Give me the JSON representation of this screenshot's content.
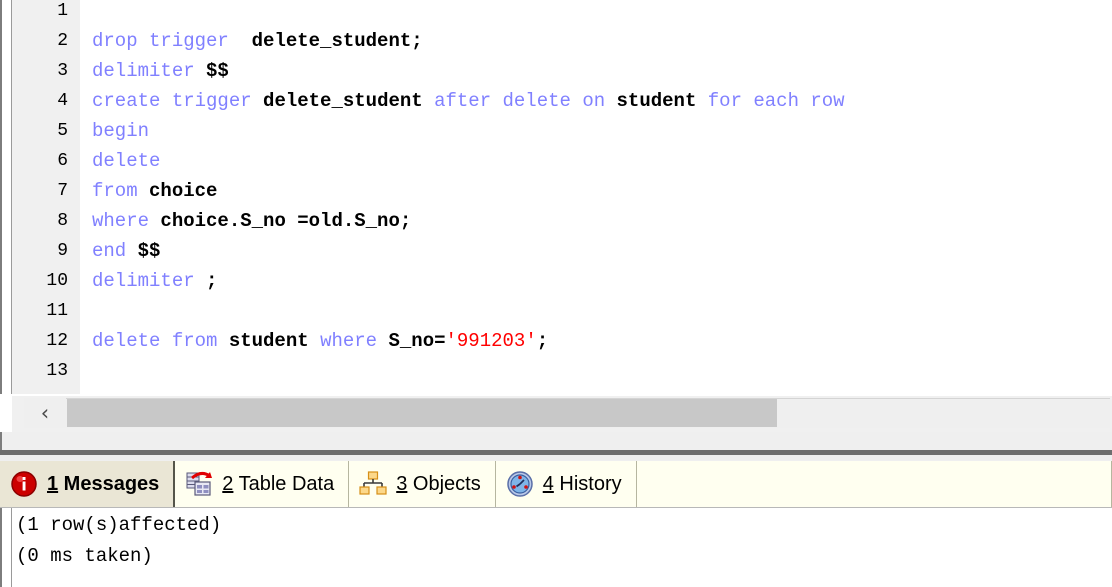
{
  "editor": {
    "lines": [
      {
        "no": "1",
        "tokens": []
      },
      {
        "no": "2",
        "tokens": [
          {
            "t": "drop trigger",
            "c": "kw"
          },
          {
            "t": "  ",
            "c": "ws"
          },
          {
            "t": "delete_student;",
            "c": "pln"
          }
        ]
      },
      {
        "no": "3",
        "tokens": [
          {
            "t": "delimiter",
            "c": "kw"
          },
          {
            "t": " ",
            "c": "ws"
          },
          {
            "t": "$$",
            "c": "pln"
          }
        ]
      },
      {
        "no": "4",
        "tokens": [
          {
            "t": "create trigger",
            "c": "kw"
          },
          {
            "t": " ",
            "c": "ws"
          },
          {
            "t": "delete_student",
            "c": "pln"
          },
          {
            "t": " ",
            "c": "ws"
          },
          {
            "t": "after delete on",
            "c": "kw"
          },
          {
            "t": " ",
            "c": "ws"
          },
          {
            "t": "student",
            "c": "pln"
          },
          {
            "t": " ",
            "c": "ws"
          },
          {
            "t": "for each row",
            "c": "kw"
          }
        ]
      },
      {
        "no": "5",
        "tokens": [
          {
            "t": "begin",
            "c": "kw"
          }
        ]
      },
      {
        "no": "6",
        "tokens": [
          {
            "t": "delete",
            "c": "kw"
          }
        ]
      },
      {
        "no": "7",
        "tokens": [
          {
            "t": "from",
            "c": "kw"
          },
          {
            "t": " ",
            "c": "ws"
          },
          {
            "t": "choice",
            "c": "pln"
          }
        ]
      },
      {
        "no": "8",
        "tokens": [
          {
            "t": "where",
            "c": "kw"
          },
          {
            "t": " ",
            "c": "ws"
          },
          {
            "t": "choice.S_no =old.S_no;",
            "c": "pln"
          }
        ]
      },
      {
        "no": "9",
        "tokens": [
          {
            "t": "end",
            "c": "kw"
          },
          {
            "t": " ",
            "c": "ws"
          },
          {
            "t": "$$",
            "c": "pln"
          }
        ]
      },
      {
        "no": "10",
        "tokens": [
          {
            "t": "delimiter",
            "c": "kw"
          },
          {
            "t": " ",
            "c": "ws"
          },
          {
            "t": ";",
            "c": "pln"
          }
        ]
      },
      {
        "no": "11",
        "tokens": []
      },
      {
        "no": "12",
        "tokens": [
          {
            "t": "delete from",
            "c": "kw"
          },
          {
            "t": " ",
            "c": "ws"
          },
          {
            "t": "student",
            "c": "pln"
          },
          {
            "t": " ",
            "c": "ws"
          },
          {
            "t": "where",
            "c": "kw"
          },
          {
            "t": " ",
            "c": "ws"
          },
          {
            "t": "S_no=",
            "c": "pln"
          },
          {
            "t": "'991203'",
            "c": "str"
          },
          {
            "t": ";",
            "c": "pln"
          }
        ]
      },
      {
        "no": "13",
        "tokens": []
      }
    ],
    "colors": {
      "keyword": "#8080ff",
      "string": "#ff0000",
      "plain": "#000000",
      "gutter_bg": "#f0f0f0",
      "editor_bg": "#ffffff"
    }
  },
  "scrollbar": {
    "left_arrow_glyph": "‹",
    "orientation": "horizontal"
  },
  "results": {
    "tabs": [
      {
        "accel": "1",
        "label": " Messages",
        "icon": "info-icon",
        "active": true
      },
      {
        "accel": "2",
        "label": " Table Data",
        "icon": "table-data-icon",
        "active": false
      },
      {
        "accel": "3",
        "label": " Objects",
        "icon": "objects-icon",
        "active": false
      },
      {
        "accel": "4",
        "label": " History",
        "icon": "history-icon",
        "active": false
      }
    ],
    "active_tab_bg": "#eae6d5",
    "tab_bg": "#fffff0",
    "output": {
      "lines": [
        "(1 row(s)affected)",
        "(0 ms taken)"
      ]
    }
  }
}
